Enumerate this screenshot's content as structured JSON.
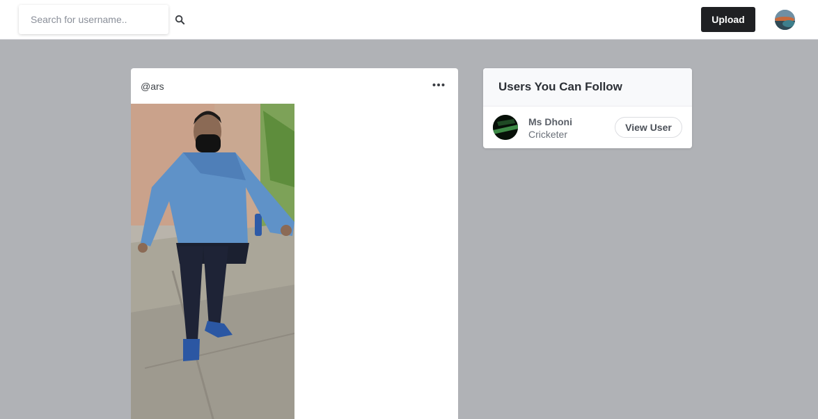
{
  "header": {
    "search_placeholder": "Search for username..",
    "search_icon": "search-icon",
    "upload_label": "Upload",
    "avatar": "profile-avatar"
  },
  "post": {
    "username": "@ars",
    "menu_icon": "ellipsis-icon",
    "image": "person-in-blue-shirt-photo"
  },
  "suggestions": {
    "title": "Users You Can Follow",
    "users": [
      {
        "name": "Ms Dhoni",
        "role": "Cricketer",
        "button_label": "View User"
      }
    ]
  },
  "colors": {
    "background": "#b0b2b6",
    "upload_button": "#1f2023",
    "card": "#ffffff"
  }
}
